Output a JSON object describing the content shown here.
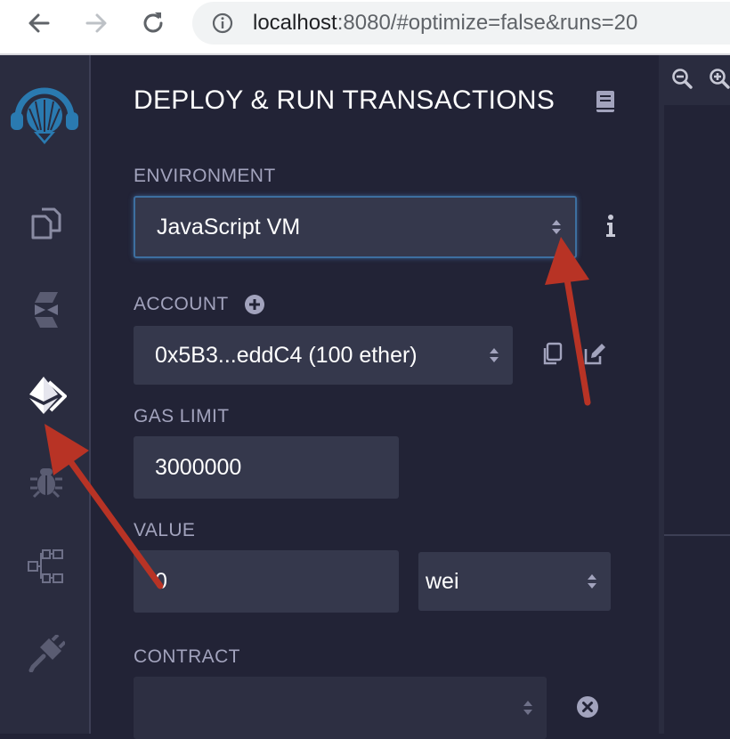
{
  "browser": {
    "url_host": "localhost",
    "url_rest": ":8080/#optimize=false&runs=20"
  },
  "icon_panel": {
    "items": [
      {
        "name": "remix-logo-icon"
      },
      {
        "name": "file-explorer-icon"
      },
      {
        "name": "solidity-compiler-icon"
      },
      {
        "name": "deploy-run-icon",
        "active": true
      },
      {
        "name": "debugger-icon"
      },
      {
        "name": "plugin-tree-icon"
      },
      {
        "name": "plugin-manager-icon"
      }
    ]
  },
  "panel": {
    "title": "DEPLOY & RUN TRANSACTIONS",
    "environment": {
      "label": "ENVIRONMENT",
      "value": "JavaScript VM"
    },
    "account": {
      "label": "ACCOUNT",
      "value": "0x5B3...eddC4 (100 ether)"
    },
    "gas_limit": {
      "label": "GAS LIMIT",
      "value": "3000000"
    },
    "value": {
      "label": "VALUE",
      "amount": "0",
      "unit": "wei"
    },
    "contract": {
      "label": "CONTRACT",
      "value": ""
    }
  },
  "colors": {
    "panel_bg": "#222336",
    "sidebar_bg": "#2a2c3f",
    "field_bg": "#35384c",
    "label": "#a2a3bd",
    "accent_logo": "#2a7ab0",
    "annotation_arrow": "#c0392b"
  }
}
